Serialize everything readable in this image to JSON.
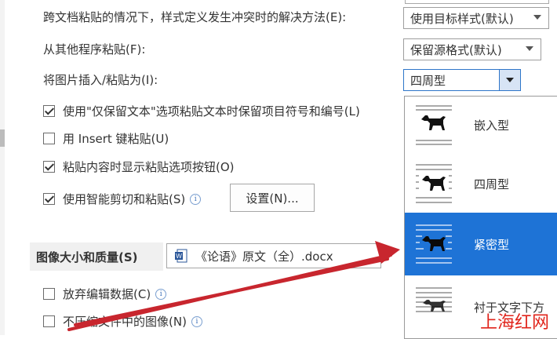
{
  "options": {
    "conflict_label": "跨文档粘贴的情况下，样式定义发生冲突时的解决方法(E):",
    "conflict_value": "使用目标样式(默认)",
    "other_program_label": "从其他程序粘贴(F):",
    "other_program_value": "保留源格式(默认)",
    "insert_picture_label": "将图片插入/粘贴为(I):",
    "insert_picture_value": "四周型",
    "keep_bullets_label": "使用\"仅保留文本\"选项粘贴文本时保留项目符号和编号(L)",
    "insert_key_label": "用 Insert 键粘贴(U)",
    "show_paste_button_label": "粘贴内容时显示粘贴选项按钮(O)",
    "smart_cut_label": "使用智能剪切和粘贴(S)",
    "settings_button": "设置(N)..."
  },
  "image_section": {
    "title": "图像大小和质量(S)",
    "file": "《论语》原文（全）.docx",
    "discard_edit_label": "放弃编辑数据(C)",
    "no_compress_label": "不压缩文件中的图像(N)"
  },
  "wrap_dropdown": {
    "items": [
      {
        "label": "嵌入型",
        "icon": "inline-wrap-icon",
        "selected": false
      },
      {
        "label": "四周型",
        "icon": "square-wrap-icon",
        "selected": false
      },
      {
        "label": "紧密型",
        "icon": "tight-wrap-icon",
        "selected": true
      },
      {
        "label": "衬于文字下方",
        "icon": "behind-text-icon",
        "selected": false
      }
    ]
  },
  "watermark": {
    "text": "上海红网"
  },
  "colors": {
    "highlight": "#1e73d6",
    "arrow": "#c8262e",
    "watermark": "#e0241b"
  }
}
